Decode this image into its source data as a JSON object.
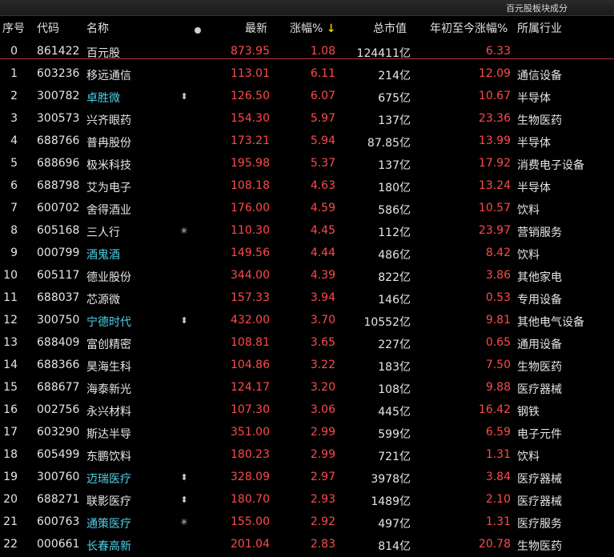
{
  "window": {
    "title": "百元股板块成分"
  },
  "columns": {
    "idx": "序号",
    "code": "代码",
    "name": "名称",
    "price": "最新",
    "pct": "涨幅%",
    "sort_icon": "arrow-down-icon",
    "cap": "总市值",
    "ytd": "年初至今涨幅%",
    "industry": "所属行业"
  },
  "colors": {
    "up": "#ff4a4a",
    "highlight_name": "#4fd1e8",
    "sort_arrow": "#f2c200",
    "separator": "#b8323c"
  },
  "rows": [
    {
      "idx": "0",
      "code": "861422",
      "name": "百元股",
      "mark": "",
      "price": "873.95",
      "pct": "1.08",
      "cap": "124411亿",
      "ytd": "6.33",
      "industry": "",
      "highlight": false
    },
    {
      "idx": "1",
      "code": "603236",
      "name": "移远通信",
      "mark": "",
      "price": "113.01",
      "pct": "6.11",
      "cap": "214亿",
      "ytd": "12.09",
      "industry": "通信设备",
      "highlight": false
    },
    {
      "idx": "2",
      "code": "300782",
      "name": "卓胜微",
      "mark": "⬍",
      "price": "126.50",
      "pct": "6.07",
      "cap": "675亿",
      "ytd": "10.67",
      "industry": "半导体",
      "highlight": true
    },
    {
      "idx": "3",
      "code": "300573",
      "name": "兴齐眼药",
      "mark": "",
      "price": "154.30",
      "pct": "5.97",
      "cap": "137亿",
      "ytd": "23.36",
      "industry": "生物医药",
      "highlight": false
    },
    {
      "idx": "4",
      "code": "688766",
      "name": "普冉股份",
      "mark": "",
      "price": "173.21",
      "pct": "5.94",
      "cap": "87.85亿",
      "ytd": "13.99",
      "industry": "半导体",
      "highlight": false
    },
    {
      "idx": "5",
      "code": "688696",
      "name": "极米科技",
      "mark": "",
      "price": "195.98",
      "pct": "5.37",
      "cap": "137亿",
      "ytd": "17.92",
      "industry": "消费电子设备",
      "highlight": false
    },
    {
      "idx": "6",
      "code": "688798",
      "name": "艾为电子",
      "mark": "",
      "price": "108.18",
      "pct": "4.63",
      "cap": "180亿",
      "ytd": "13.24",
      "industry": "半导体",
      "highlight": false
    },
    {
      "idx": "7",
      "code": "600702",
      "name": "舍得酒业",
      "mark": "",
      "price": "176.00",
      "pct": "4.59",
      "cap": "586亿",
      "ytd": "10.57",
      "industry": "饮料",
      "highlight": false
    },
    {
      "idx": "8",
      "code": "605168",
      "name": "三人行",
      "mark": "✳",
      "price": "110.30",
      "pct": "4.45",
      "cap": "112亿",
      "ytd": "23.97",
      "industry": "营销服务",
      "highlight": false
    },
    {
      "idx": "9",
      "code": "000799",
      "name": "酒鬼酒",
      "mark": "",
      "price": "149.56",
      "pct": "4.44",
      "cap": "486亿",
      "ytd": "8.42",
      "industry": "饮料",
      "highlight": true
    },
    {
      "idx": "10",
      "code": "605117",
      "name": "德业股份",
      "mark": "",
      "price": "344.00",
      "pct": "4.39",
      "cap": "822亿",
      "ytd": "3.86",
      "industry": "其他家电",
      "highlight": false
    },
    {
      "idx": "11",
      "code": "688037",
      "name": "芯源微",
      "mark": "",
      "price": "157.33",
      "pct": "3.94",
      "cap": "146亿",
      "ytd": "0.53",
      "industry": "专用设备",
      "highlight": false
    },
    {
      "idx": "12",
      "code": "300750",
      "name": "宁德时代",
      "mark": "⬍",
      "price": "432.00",
      "pct": "3.70",
      "cap": "10552亿",
      "ytd": "9.81",
      "industry": "其他电气设备",
      "highlight": true
    },
    {
      "idx": "13",
      "code": "688409",
      "name": "富创精密",
      "mark": "",
      "price": "108.81",
      "pct": "3.65",
      "cap": "227亿",
      "ytd": "0.65",
      "industry": "通用设备",
      "highlight": false
    },
    {
      "idx": "14",
      "code": "688366",
      "name": "昊海生科",
      "mark": "",
      "price": "104.86",
      "pct": "3.22",
      "cap": "183亿",
      "ytd": "7.50",
      "industry": "生物医药",
      "highlight": false
    },
    {
      "idx": "15",
      "code": "688677",
      "name": "海泰新光",
      "mark": "",
      "price": "124.17",
      "pct": "3.20",
      "cap": "108亿",
      "ytd": "9.88",
      "industry": "医疗器械",
      "highlight": false
    },
    {
      "idx": "16",
      "code": "002756",
      "name": "永兴材料",
      "mark": "",
      "price": "107.30",
      "pct": "3.06",
      "cap": "445亿",
      "ytd": "16.42",
      "industry": "钢铁",
      "highlight": false
    },
    {
      "idx": "17",
      "code": "603290",
      "name": "斯达半导",
      "mark": "",
      "price": "351.00",
      "pct": "2.99",
      "cap": "599亿",
      "ytd": "6.59",
      "industry": "电子元件",
      "highlight": false
    },
    {
      "idx": "18",
      "code": "605499",
      "name": "东鹏饮料",
      "mark": "",
      "price": "180.23",
      "pct": "2.99",
      "cap": "721亿",
      "ytd": "1.31",
      "industry": "饮料",
      "highlight": false
    },
    {
      "idx": "19",
      "code": "300760",
      "name": "迈瑞医疗",
      "mark": "⬍",
      "price": "328.09",
      "pct": "2.97",
      "cap": "3978亿",
      "ytd": "3.84",
      "industry": "医疗器械",
      "highlight": true
    },
    {
      "idx": "20",
      "code": "688271",
      "name": "联影医疗",
      "mark": "⬍",
      "price": "180.70",
      "pct": "2.93",
      "cap": "1489亿",
      "ytd": "2.10",
      "industry": "医疗器械",
      "highlight": false
    },
    {
      "idx": "21",
      "code": "600763",
      "name": "通策医疗",
      "mark": "✳",
      "price": "155.00",
      "pct": "2.92",
      "cap": "497亿",
      "ytd": "1.31",
      "industry": "医疗服务",
      "highlight": true
    },
    {
      "idx": "22",
      "code": "000661",
      "name": "长春高新",
      "mark": "",
      "price": "201.04",
      "pct": "2.83",
      "cap": "814亿",
      "ytd": "20.78",
      "industry": "生物医药",
      "highlight": true
    }
  ]
}
